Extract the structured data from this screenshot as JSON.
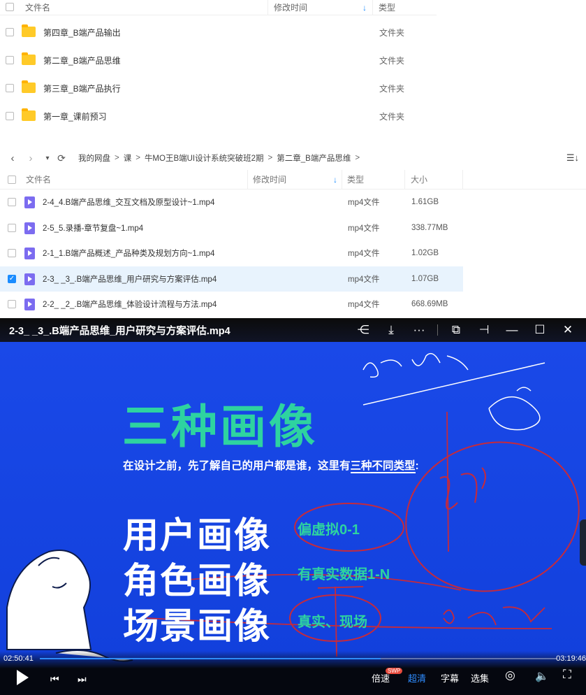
{
  "list_top": {
    "headers": {
      "name": "文件名",
      "time": "修改时间",
      "type": "类型"
    },
    "rows": [
      {
        "name": "第四章_B端产品输出",
        "type": "文件夹"
      },
      {
        "name": "第二章_B端产品思维",
        "type": "文件夹"
      },
      {
        "name": "第三章_B端产品执行",
        "type": "文件夹"
      },
      {
        "name": "第一章_课前预习",
        "type": "文件夹"
      }
    ]
  },
  "toolbar": {
    "back": "‹",
    "forward": "›",
    "dropdown": "▾",
    "refresh": "⟳",
    "crumbs": [
      "我的网盘",
      "课",
      "牛MO王B端UI设计系统突破班2期",
      "第二章_B端产品思维"
    ],
    "sort_icon": "☰↓"
  },
  "list_bottom": {
    "headers": {
      "name": "文件名",
      "time": "修改时间",
      "type": "类型",
      "size": "大小"
    },
    "rows": [
      {
        "name": "2-4_4.B端产品思维_交互文档及原型设计~1.mp4",
        "type": "mp4文件",
        "size": "1.61GB",
        "selected": false
      },
      {
        "name": "2-5_5.录播-章节复盘~1.mp4",
        "type": "mp4文件",
        "size": "338.77MB",
        "selected": false
      },
      {
        "name": "2-1_1.B端产品概述_产品种类及规划方向~1.mp4",
        "type": "mp4文件",
        "size": "1.02GB",
        "selected": false
      },
      {
        "name": "2-3_ _3_.B端产品思维_用户研究与方案评估.mp4",
        "type": "mp4文件",
        "size": "1.07GB",
        "selected": true
      },
      {
        "name": "2-2_ _2_.B端产品思维_体验设计流程与方法.mp4",
        "type": "mp4文件",
        "size": "668.69MB",
        "selected": false
      }
    ]
  },
  "player": {
    "title": "2-3_ _3_.B端产品思维_用户研究与方案评估.mp4",
    "slide": {
      "heading": "三种画像",
      "intro_pre": "在设计之前，先了解自己的用户都是谁，这里有",
      "intro_em": "三种不同类型",
      "intro_post": ":",
      "personas": [
        {
          "label": "用户画像",
          "tag": "偏虚拟0-1"
        },
        {
          "label": "角色画像",
          "tag": "有真实数据1-N"
        },
        {
          "label": "场景画像",
          "tag": "真实、现场"
        }
      ]
    },
    "time_current": "02:50:41",
    "time_total": "03:19:46",
    "progress": 0.66,
    "controls": {
      "speed": "倍速",
      "swp": "SWP",
      "quality": "超清",
      "subtitle": "字幕",
      "episodes": "选集"
    },
    "accent_color": "#2ed3a0",
    "slide_bg": "#1747e0"
  }
}
